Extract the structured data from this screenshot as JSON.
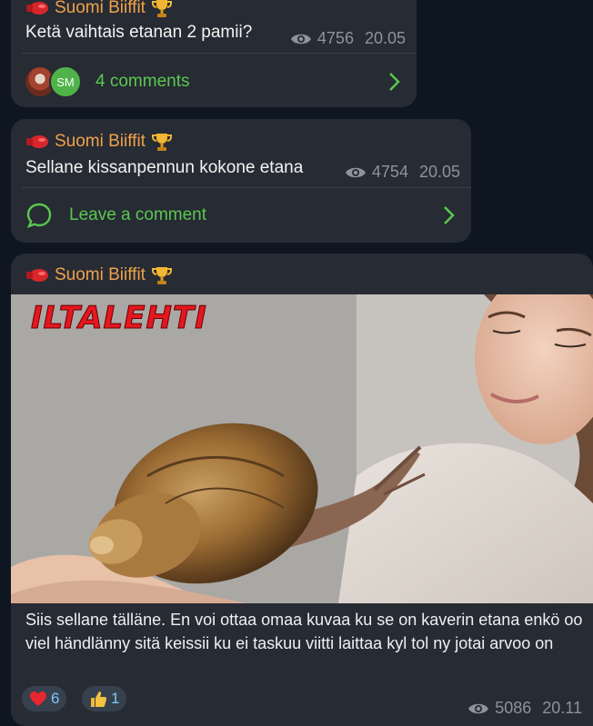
{
  "messages": [
    {
      "sender": "Suomi Biiffit",
      "text": "Ketä vaihtais etanan 2 pamii?",
      "views": "4756",
      "time": "20.05",
      "comments_label": "4 comments",
      "avatar_initials": "SM"
    },
    {
      "sender": "Suomi Biiffit",
      "text": "Sellane kissanpennun kokone etana",
      "views": "4754",
      "time": "20.05",
      "comments_label": "Leave a comment"
    },
    {
      "sender": "Suomi Biiffit",
      "photo_brand": "ILTALEHTI",
      "text": "Siis sellane tälläne. En voi ottaa omaa kuvaa ku se on kaverin etana enkö oo viel händlänny sitä keissii ku ei taskuu viitti laittaa kyl tol ny jotai arvoo on",
      "reactions": [
        {
          "emoji": "❤️",
          "count": "6"
        },
        {
          "emoji": "👍",
          "count": "1"
        }
      ],
      "views": "5086",
      "time": "20.11"
    }
  ],
  "colors": {
    "background": "#0e1621",
    "bubble": "#272b33",
    "sender": "#f0a24a",
    "link_green": "#59c84f",
    "meta_gray": "#8c939c"
  },
  "icons": [
    "boxing-glove-icon",
    "trophy-icon",
    "eye-icon",
    "chevron-right-icon",
    "comment-bubble-icon",
    "heart-icon",
    "thumbs-up-icon"
  ]
}
